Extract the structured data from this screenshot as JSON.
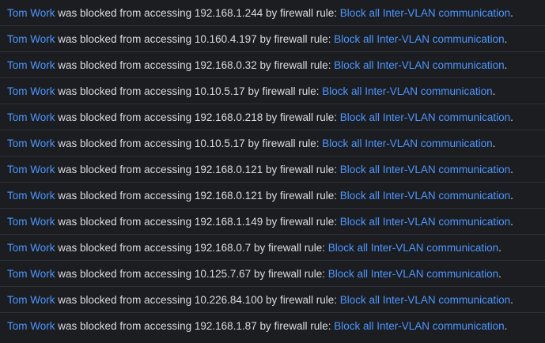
{
  "colors": {
    "background": "#1c1d21",
    "text": "#dcdde0",
    "link": "#4d97ff",
    "divider": "#2e3036"
  },
  "log": {
    "entries": [
      {
        "user": "Tom Work",
        "action": "was blocked from accessing",
        "target": "192.168.1.244",
        "by": "by firewall rule:",
        "rule": "Block all Inter-VLAN communication",
        "end": "."
      },
      {
        "user": "Tom Work",
        "action": "was blocked from accessing",
        "target": "10.160.4.197",
        "by": "by firewall rule:",
        "rule": "Block all Inter-VLAN communication",
        "end": "."
      },
      {
        "user": "Tom Work",
        "action": "was blocked from accessing",
        "target": "192.168.0.32",
        "by": "by firewall rule:",
        "rule": "Block all Inter-VLAN communication",
        "end": "."
      },
      {
        "user": "Tom Work",
        "action": "was blocked from accessing",
        "target": "10.10.5.17",
        "by": "by firewall rule:",
        "rule": "Block all Inter-VLAN communication",
        "end": "."
      },
      {
        "user": "Tom Work",
        "action": "was blocked from accessing",
        "target": "192.168.0.218",
        "by": "by firewall rule:",
        "rule": "Block all Inter-VLAN communication",
        "end": "."
      },
      {
        "user": "Tom Work",
        "action": "was blocked from accessing",
        "target": "10.10.5.17",
        "by": "by firewall rule:",
        "rule": "Block all Inter-VLAN communication",
        "end": "."
      },
      {
        "user": "Tom Work",
        "action": "was blocked from accessing",
        "target": "192.168.0.121",
        "by": "by firewall rule:",
        "rule": "Block all Inter-VLAN communication",
        "end": "."
      },
      {
        "user": "Tom Work",
        "action": "was blocked from accessing",
        "target": "192.168.0.121",
        "by": "by firewall rule:",
        "rule": "Block all Inter-VLAN communication",
        "end": "."
      },
      {
        "user": "Tom Work",
        "action": "was blocked from accessing",
        "target": "192.168.1.149",
        "by": "by firewall rule:",
        "rule": "Block all Inter-VLAN communication",
        "end": "."
      },
      {
        "user": "Tom Work",
        "action": "was blocked from accessing",
        "target": "192.168.0.7",
        "by": "by firewall rule:",
        "rule": "Block all Inter-VLAN communication",
        "end": "."
      },
      {
        "user": "Tom Work",
        "action": "was blocked from accessing",
        "target": "10.125.7.67",
        "by": "by firewall rule:",
        "rule": "Block all Inter-VLAN communication",
        "end": "."
      },
      {
        "user": "Tom Work",
        "action": "was blocked from accessing",
        "target": "10.226.84.100",
        "by": "by firewall rule:",
        "rule": "Block all Inter-VLAN communication",
        "end": "."
      },
      {
        "user": "Tom Work",
        "action": "was blocked from accessing",
        "target": "192.168.1.87",
        "by": "by firewall rule:",
        "rule": "Block all Inter-VLAN communication",
        "end": "."
      }
    ]
  }
}
